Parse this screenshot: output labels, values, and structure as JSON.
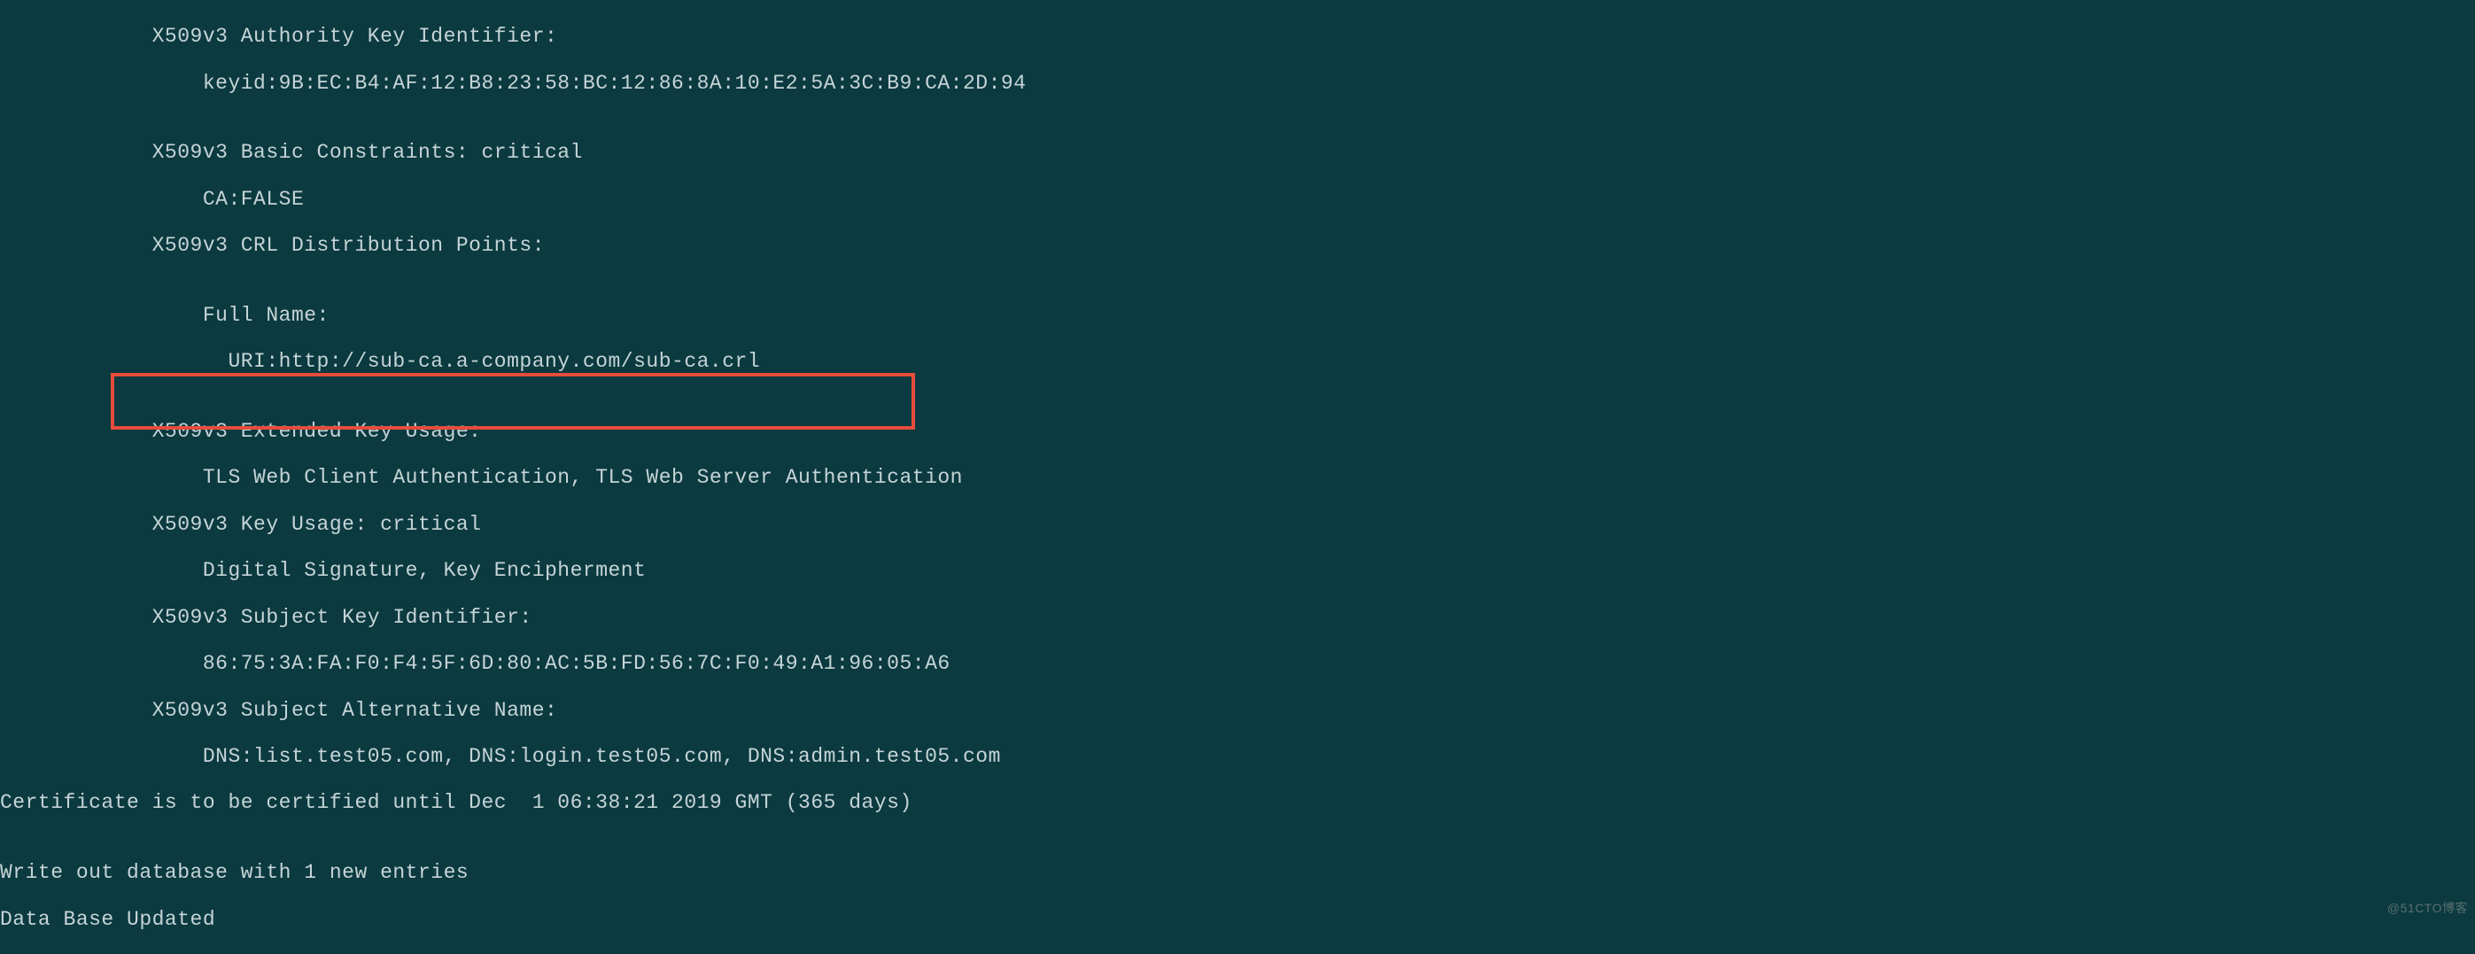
{
  "cert": {
    "x509_aki_label": "            X509v3 Authority Key Identifier: ",
    "x509_aki_value": "                keyid:9B:EC:B4:AF:12:B8:23:58:BC:12:86:8A:10:E2:5A:3C:B9:CA:2D:94",
    "blank1": "",
    "x509_bc_label": "            X509v3 Basic Constraints: critical",
    "x509_bc_value": "                CA:FALSE",
    "x509_crl_label": "            X509v3 CRL Distribution Points: ",
    "blank2": "",
    "x509_crl_fullname": "                Full Name:",
    "x509_crl_uri": "                  URI:http://sub-ca.a-company.com/sub-ca.crl",
    "blank3": "",
    "x509_eku_label": "            X509v3 Extended Key Usage: ",
    "x509_eku_value": "                TLS Web Client Authentication, TLS Web Server Authentication",
    "x509_ku_label": "            X509v3 Key Usage: critical",
    "x509_ku_value": "                Digital Signature, Key Encipherment",
    "x509_ski_label": "            X509v3 Subject Key Identifier: ",
    "x509_ski_value": "                86:75:3A:FA:F0:F4:5F:6D:80:AC:5B:FD:56:7C:F0:49:A1:96:05:A6",
    "x509_san_label": "            X509v3 Subject Alternative Name: ",
    "x509_san_value": "                DNS:list.test05.com, DNS:login.test05.com, DNS:admin.test05.com",
    "cert_until": "Certificate is to be certified until Dec  1 06:38:21 2019 GMT (365 days)",
    "blank4": "",
    "write_out": "Write out database with 1 new entries",
    "db_updated": "Data Base Updated"
  },
  "watermark": "@51CTO博客"
}
